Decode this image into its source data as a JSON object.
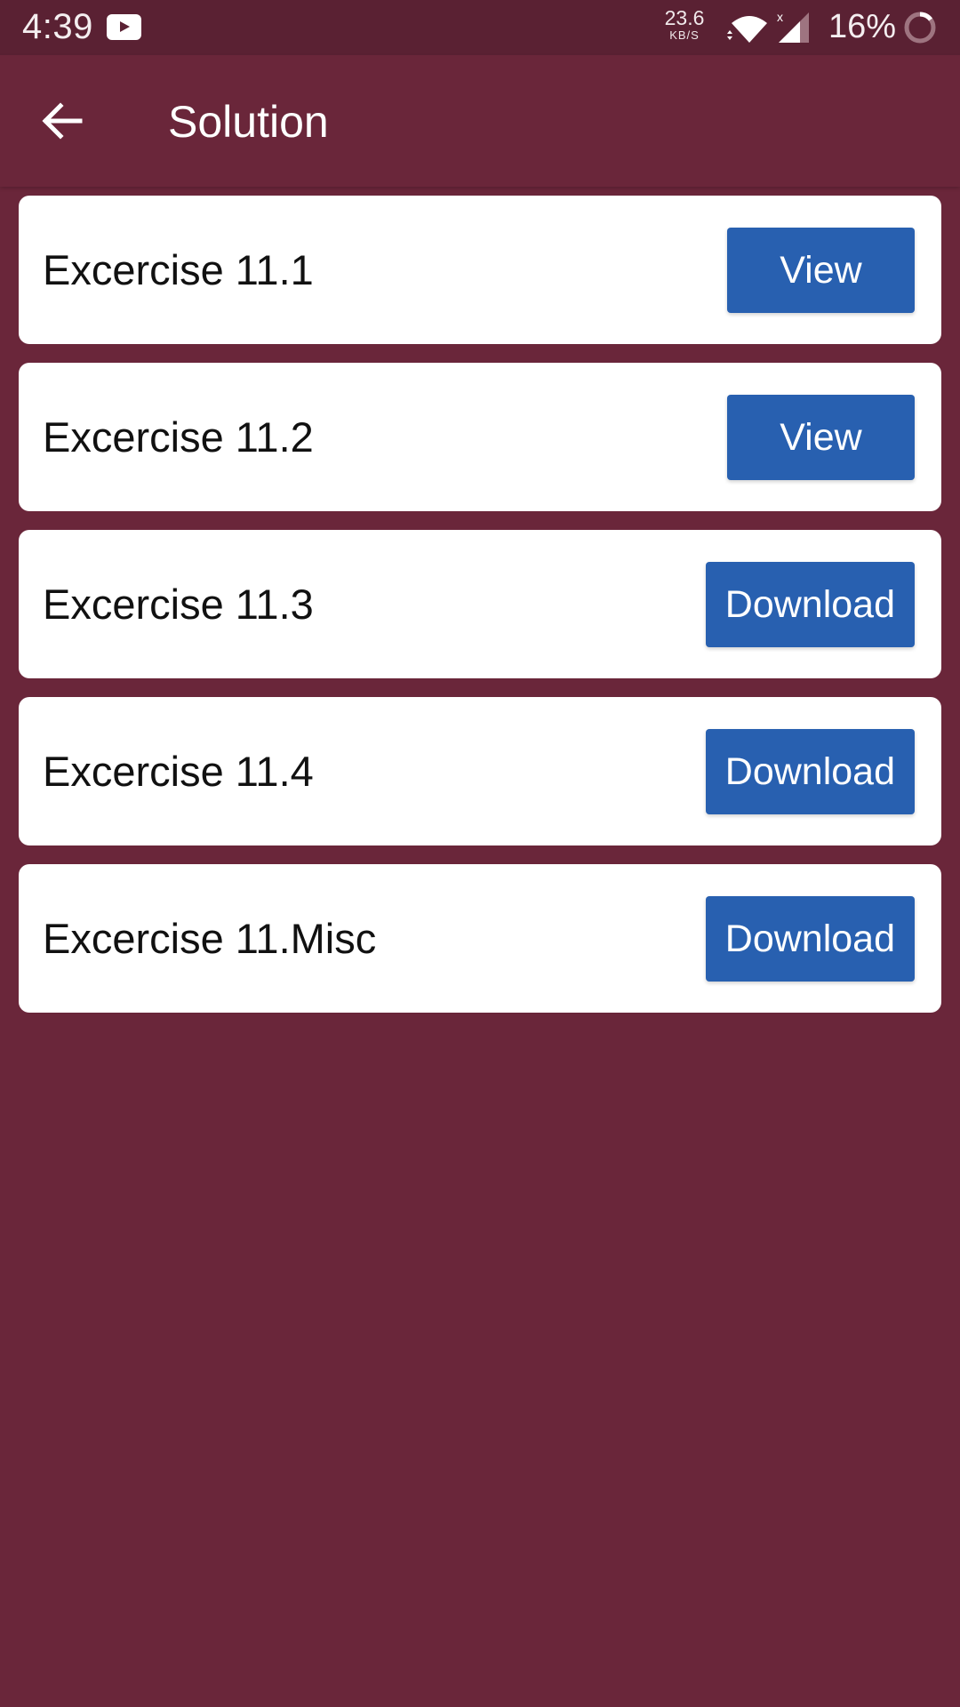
{
  "status_bar": {
    "time": "4:39",
    "notification_icons": [
      "youtube-icon"
    ],
    "net_speed_value": "23.6",
    "net_speed_unit": "KB/S",
    "wifi_icon": "wifi-icon",
    "signal_icon": "signal-icon",
    "signal_label": "x",
    "battery_percent": "16%",
    "battery_level": 0.16
  },
  "app_bar": {
    "back_icon": "arrow-back-icon",
    "title": "Solution"
  },
  "colors": {
    "background": "#6a263a",
    "status_bar": "#5a2133",
    "button": "#2860b0",
    "card": "#ffffff"
  },
  "exercises": [
    {
      "label": "Excercise 11.1",
      "action": "View"
    },
    {
      "label": "Excercise 11.2",
      "action": "View"
    },
    {
      "label": "Excercise 11.3",
      "action": "Download"
    },
    {
      "label": "Excercise 11.4",
      "action": "Download"
    },
    {
      "label": "Excercise 11.Misc",
      "action": "Download"
    }
  ]
}
